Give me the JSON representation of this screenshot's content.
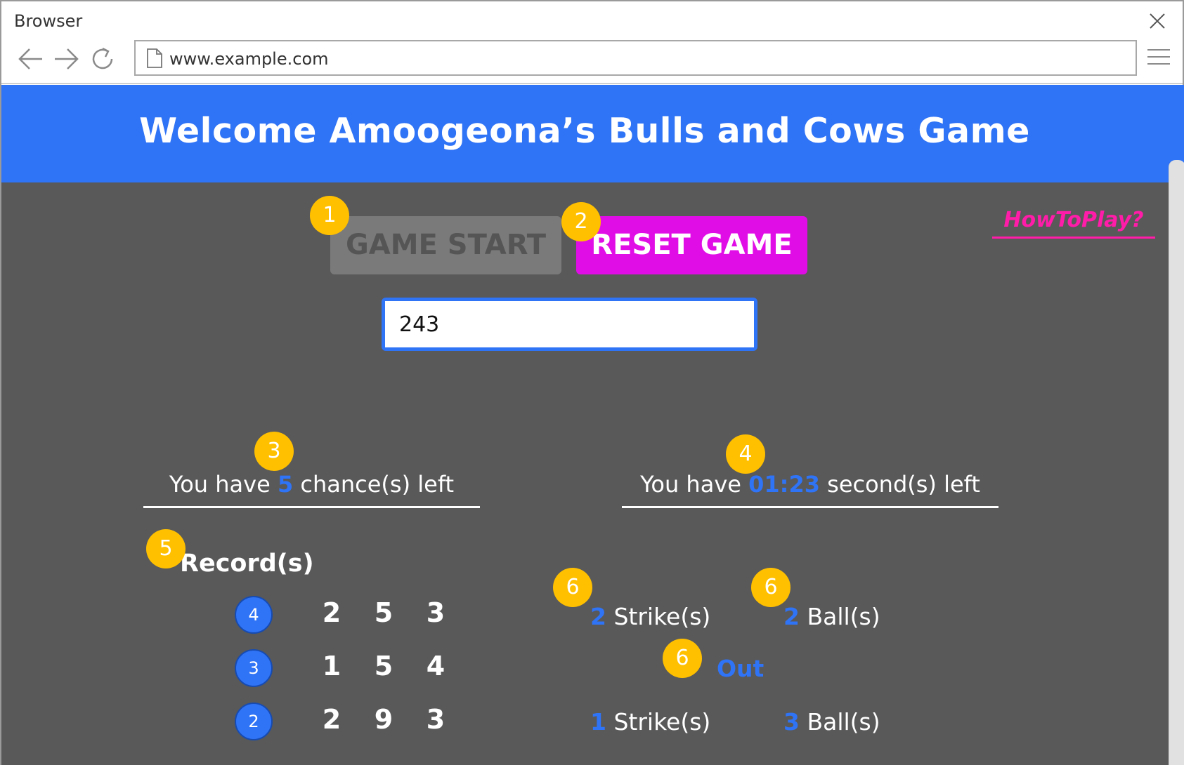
{
  "browser": {
    "window_title": "Browser",
    "url": "www.example.com",
    "icons": [
      "back-arrow-icon",
      "forward-arrow-icon",
      "reload-icon",
      "page-icon",
      "hamburger-menu-icon",
      "close-icon"
    ]
  },
  "game": {
    "title": "Welcome Amoogeona’s Bulls and Cows Game",
    "start_label": "GAME START",
    "reset_label": "RESET GAME",
    "howto_label": "HowToPlay?",
    "guess_value": "243",
    "chances": {
      "prefix": "You have ",
      "value": "5",
      "suffix": " chance(s) left"
    },
    "timer": {
      "prefix": "You have ",
      "value": "01:23",
      "suffix": " second(s) left"
    },
    "records_heading": "Record(s)",
    "records": [
      {
        "num": "4",
        "digits": [
          "2",
          "5",
          "3"
        ]
      },
      {
        "num": "3",
        "digits": [
          "1",
          "5",
          "4"
        ]
      },
      {
        "num": "2",
        "digits": [
          "2",
          "9",
          "3"
        ]
      }
    ],
    "results": {
      "row1_strike_count": "2",
      "row1_strike_label": " Strike(s)",
      "row1_ball_count": "2",
      "row1_ball_label": " Ball(s)",
      "out_label": "Out",
      "row3_strike_count": "1",
      "row3_strike_label": " Strike(s)",
      "row3_ball_count": "3",
      "row3_ball_label": " Ball(s)"
    }
  },
  "annotations": {
    "b1": "1",
    "b2": "2",
    "b3": "3",
    "b4": "4",
    "b5": "5",
    "b6": "6"
  },
  "colors": {
    "header_blue": "#2f73f6",
    "page_gray": "#595959",
    "reset_magenta": "#e10de6",
    "howto_pink": "#ff1ca8",
    "badge_yellow": "#ffc000",
    "start_disabled_gray": "#7a7a7a"
  }
}
